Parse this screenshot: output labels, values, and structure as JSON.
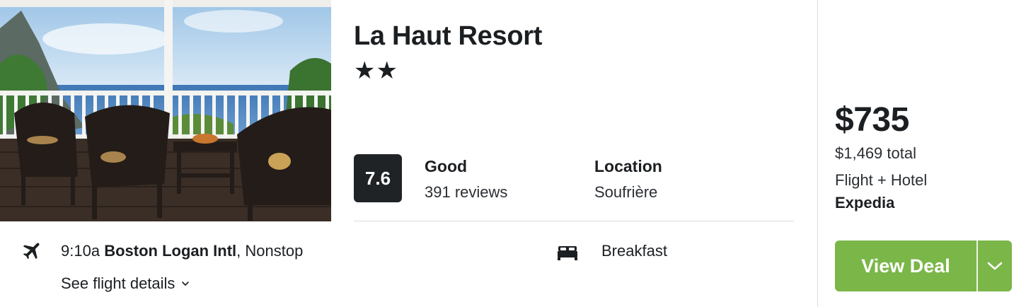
{
  "hotel": {
    "name": "La Haut Resort",
    "stars": "★★",
    "star_count": 2,
    "score": "7.6",
    "rating_word": "Good",
    "reviews": "391 reviews",
    "location_label": "Location",
    "location_value": "Soufrière"
  },
  "flight": {
    "time": "9:10a",
    "airport": "Boston Logan Intl",
    "stops": ", Nonstop",
    "details_link": "See flight details",
    "icon": "plane-icon"
  },
  "amenity": {
    "label": "Breakfast",
    "icon": "bed-icon"
  },
  "pricing": {
    "price": "$735",
    "total": "$1,469 total",
    "package": "Flight + Hotel",
    "provider": "Expedia",
    "cta_label": "View Deal"
  },
  "colors": {
    "accent_green": "#7ab648",
    "score_badge": "#1f2326",
    "text": "#1c1f22"
  }
}
